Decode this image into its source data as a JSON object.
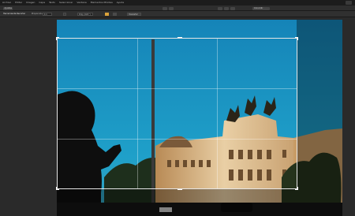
{
  "menu": {
    "items": [
      "Archivo",
      "Editar",
      "Imagen",
      "Capa",
      "Texto",
      "Seleccionar",
      "Ventana",
      "Elementos Móviles",
      "Ayuda"
    ]
  },
  "toolbar": {
    "mode_label": "Ajustes",
    "right_label": "Coincidir",
    "buttons": [
      "Ajustar",
      "Aplicar"
    ]
  },
  "options_bar": {
    "title": "Herramienta Recortar",
    "ratio_label": "Proporción:",
    "ratio_value": "1:1",
    "ratio_select": "Orig. (4×6 ″)",
    "action_label": "Descartar"
  },
  "colors": {
    "sky": "#1b93c4",
    "building": "#e0c29a",
    "dark": "#0f0f0f",
    "accent": "#d9a23a"
  }
}
